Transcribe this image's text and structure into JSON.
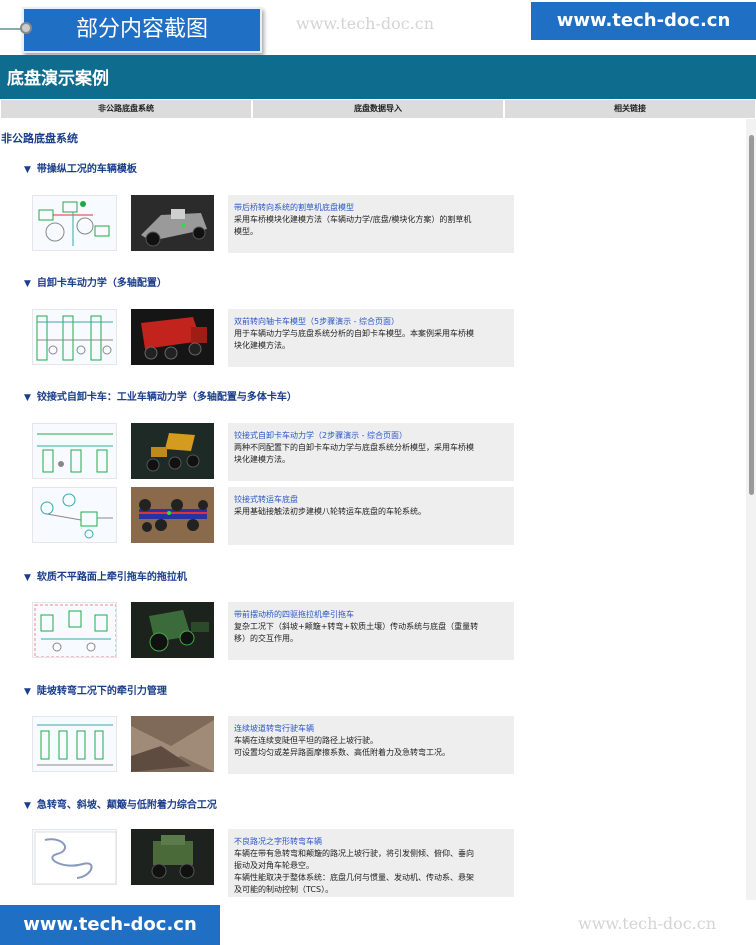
{
  "banner": {
    "label": "部分内容截图",
    "watermark": "www.tech-doc.cn",
    "site": "www.tech-doc.cn"
  },
  "header": {
    "title": "底盘演示案例"
  },
  "tabs": [
    "非公路底盘系统",
    "底盘数据导入",
    "相关链接"
  ],
  "section": {
    "title": "非公路底盘系统"
  },
  "groups": [
    {
      "title": "带操纵工况的车辆模板"
    },
    {
      "title": "自卸卡车动力学（多轴配置）"
    },
    {
      "title": "铰接式自卸卡车：工业车辆动力学（多轴配置与多体卡车）"
    },
    {
      "title": "软质不平路面上牵引拖车的拖拉机"
    },
    {
      "title": "陡坡转弯工况下的牵引力管理"
    },
    {
      "title": "急转弯、斜坡、颠簸与低附着力综合工况"
    }
  ],
  "cards": [
    {
      "title": "带后桥转向系统的割草机底盘模型",
      "lines": [
        "采用车桥模块化建模方法（车辆动力学/底盘/模块化方案）的割草机",
        "模型。"
      ]
    },
    {
      "title": "双前转向轴卡车模型（5步骤演示 - 综合页面）",
      "lines": [
        "用于车辆动力学与底盘系统分析的自卸卡车模型。本案例采用车桥模",
        "块化建模方法。"
      ]
    },
    {
      "title": "铰接式自卸卡车动力学（2步骤演示 - 综合页面）",
      "lines": [
        "两种不同配置下的自卸卡车动力学与底盘系统分析模型，采用车桥模",
        "块化建模方法。"
      ]
    },
    {
      "title": "铰接式转运车底盘",
      "lines": [
        "采用基础接触法初步建模八轮转运车底盘的车轮系统。"
      ]
    },
    {
      "title": "带前摆动桥的四驱拖拉机牵引拖车",
      "lines": [
        "复杂工况下（斜坡+颠簸+转弯+软质土壤）传动系统与底盘（重量转",
        "移）的交互作用。"
      ]
    },
    {
      "title": "连续坡道转弯行驶车辆",
      "lines": [
        "车辆在连续变陡但平坦的路径上坡行驶。",
        "可设置均匀或差异路面摩擦系数、高低附着力及急转弯工况。"
      ]
    },
    {
      "title": "不良路况之字形转弯车辆",
      "lines": [
        "车辆在带有急转弯和颠簸的路况上坡行驶，将引发侧倾、俯仰、垂向",
        "振动及对角车轮悬空。",
        "车辆性能取决于整体系统：底盘几何与惯量、发动机、传动系、悬架",
        "及可能的制动控制（TCS）。"
      ]
    }
  ],
  "colors": {
    "accent": "#1f6fc4",
    "header": "#0e6d8e",
    "link": "#2a56c6",
    "heading": "#1a3d8a"
  }
}
